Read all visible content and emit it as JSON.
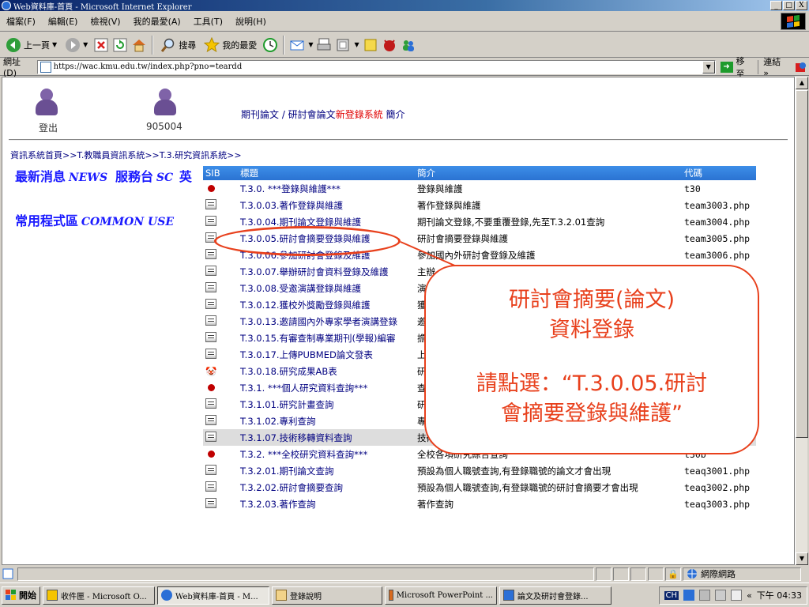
{
  "window": {
    "title": "Web資料庫-首頁 - Microsoft Internet Explorer",
    "buttons": [
      "_",
      "□",
      "X"
    ]
  },
  "menu": [
    "檔案(F)",
    "編輯(E)",
    "檢視(V)",
    "我的最愛(A)",
    "工具(T)",
    "說明(H)"
  ],
  "toolbar": {
    "back": "上一頁",
    "search": "搜尋",
    "favorites": "我的最愛"
  },
  "address": {
    "label": "網址(D)",
    "url": "https://wac.kmu.edu.tw/index.php?pno=teardd",
    "go": "移至",
    "links": "連結 »"
  },
  "page": {
    "logout_label": "登出",
    "user_id": "905004",
    "system_prefix": "期刊論文 / 研討會論文",
    "system_red": "新登錄系統",
    "system_suffix": " 簡介",
    "breadcrumb": "資訊系統首頁>>T.教職員資訊系統>>T.3.研究資訊系統>>",
    "nav_news": "最新消息",
    "nav_news_en": "NEWS",
    "nav_desk": "服務台",
    "nav_desk_en": "SC",
    "nav_more": "英",
    "nav_common": "常用程式區",
    "nav_common_en": "COMMON USE"
  },
  "table": {
    "headers": [
      "SIB",
      "標題",
      "簡介",
      "代碼"
    ],
    "rows": [
      {
        "icon": "bullet",
        "title": "T.3.0. ***登錄與維護***",
        "desc": "登錄與維護",
        "code": "t30"
      },
      {
        "icon": "doc",
        "title": "T.3.0.03.著作登錄與維護",
        "desc": "著作登錄與維護",
        "code": "team3003.php"
      },
      {
        "icon": "doc",
        "title": "T.3.0.04.期刊論文登錄與維護",
        "desc": "期刊論文登錄,不要重覆登錄,先至T.3.2.01查詢",
        "code": "team3004.php"
      },
      {
        "icon": "doc",
        "title": "T.3.0.05.研討會摘要登錄與維護",
        "desc": "研討會摘要登錄與維護",
        "code": "team3005.php"
      },
      {
        "icon": "doc",
        "title": "T.3.0.06.參加研討會登錄及維護",
        "desc": "參加國內外研討會登錄及維護",
        "code": "team3006.php"
      },
      {
        "icon": "doc",
        "title": "T.3.0.07.舉辦研討會資料登錄及維護",
        "desc": "主辦",
        "code": "p"
      },
      {
        "icon": "doc",
        "title": "T.3.0.08.受邀演講登錄與維護",
        "desc": "演",
        "code": ""
      },
      {
        "icon": "doc",
        "title": "T.3.0.12.獲校外獎勵登錄與維護",
        "desc": "獲",
        "code": ""
      },
      {
        "icon": "doc",
        "title": "T.3.0.13.邀請國內外專家學者演講登錄",
        "desc": "邀",
        "code": ""
      },
      {
        "icon": "doc",
        "title": "T.3.0.15.有審查制專業期刊(學報)編審",
        "desc": "擔",
        "code": ""
      },
      {
        "icon": "doc",
        "title": "T.3.0.17.上傳PUBMED論文發表",
        "desc": "上",
        "code": ""
      },
      {
        "icon": "clown",
        "title": "T.3.0.18.研究成果AB表",
        "desc": "研",
        "code": ""
      },
      {
        "icon": "bullet",
        "title": "T.3.1. ***個人研究資料查詢***",
        "desc": "查",
        "code": ""
      },
      {
        "icon": "doc",
        "title": "T.3.1.01.研究計畫查詢",
        "desc": "研究",
        "code": "p"
      },
      {
        "icon": "doc",
        "title": "T.3.1.02.專利查詢",
        "desc": "專利查詢",
        "code": "team3002.php"
      },
      {
        "icon": "doc",
        "title": "T.3.1.07.技術移轉資料查詢",
        "desc": "技術移轉資料查詢",
        "code": "team3007.php",
        "highlight": true
      },
      {
        "icon": "bullet",
        "title": "T.3.2. ***全校研究資料查詢***",
        "desc": "全校各項研究綜合查詢",
        "code": "t30b"
      },
      {
        "icon": "doc",
        "title": "T.3.2.01.期刊論文查詢",
        "desc": "預設為個人職號查詢,有登錄職號的論文才會出現",
        "code": "teaq3001.php"
      },
      {
        "icon": "doc",
        "title": "T.3.2.02.研討會摘要查詢",
        "desc": "預設為個人職號查詢,有登錄職號的研討會摘要才會出現",
        "code": "teaq3002.php"
      },
      {
        "icon": "doc",
        "title": "T.3.2.03.著作查詢",
        "desc": "著作查詢",
        "code": "teaq3003.php"
      }
    ]
  },
  "callout": {
    "line1": "研討會摘要(論文)",
    "line2": "資料登錄",
    "line3": "請點選：“T.3.0.05.研討",
    "line4": "會摘要登錄與維護”"
  },
  "status": {
    "zone": "網際網路"
  },
  "taskbar": {
    "start": "開始",
    "tasks": [
      "收件匣 - Microsoft O...",
      "Web資料庫-首頁 - M...",
      "登錄說明",
      "Microsoft PowerPoint ...",
      "論文及研討會登錄..."
    ],
    "lang": "CH",
    "clock": "下午 04:33"
  },
  "colors": {
    "accent": "#e8401c",
    "header_blue": "#2b73d2",
    "link": "#000080"
  }
}
